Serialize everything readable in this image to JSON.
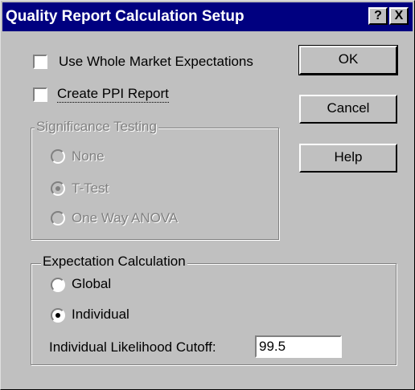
{
  "window": {
    "title": "Quality Report Calculation Setup",
    "help_glyph": "?",
    "close_glyph": "X"
  },
  "options": {
    "use_whole_market": {
      "label": "Use Whole Market Expectations",
      "checked": false
    },
    "create_ppi": {
      "label": "Create PPI Report",
      "checked": false
    }
  },
  "significance": {
    "legend": "Significance Testing",
    "enabled": false,
    "options": [
      {
        "label": "None",
        "selected": false
      },
      {
        "label": "T-Test",
        "selected": true
      },
      {
        "label": "One Way ANOVA",
        "selected": false
      }
    ]
  },
  "expectation": {
    "legend": "Expectation Calculation",
    "options": [
      {
        "label": "Global",
        "selected": false
      },
      {
        "label": "Individual",
        "selected": true
      }
    ],
    "cutoff_label": "Individual Likelihood Cutoff:",
    "cutoff_value": "99.5"
  },
  "buttons": {
    "ok": "OK",
    "cancel": "Cancel",
    "help": "Help"
  }
}
